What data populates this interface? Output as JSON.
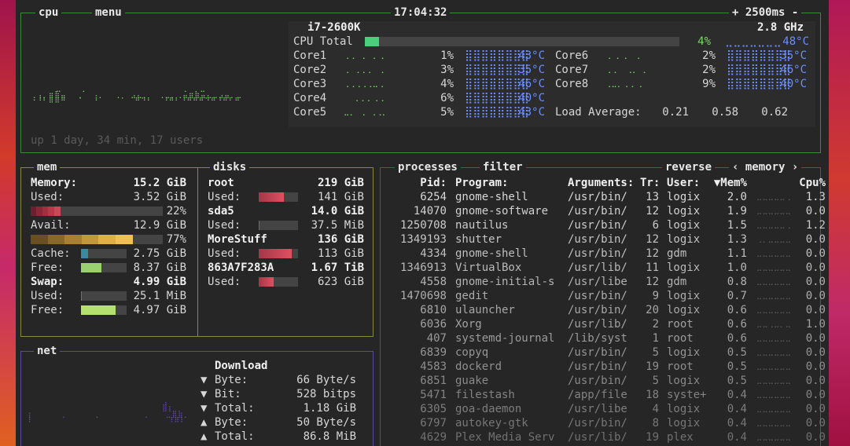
{
  "cpu": {
    "title": "cpu",
    "menu_label": "menu",
    "clock": "17:04:32",
    "interval": "+ 2500ms -",
    "model": "i7-2600K",
    "freq": "2.8 GHz",
    "total": {
      "label": "CPU Total",
      "pct": "4%",
      "temp": "48°C",
      "fill": 0.04
    },
    "cores": [
      {
        "label": "Core1",
        "pct": "1%",
        "temp": "43°C"
      },
      {
        "label": "Core2",
        "pct": "3%",
        "temp": "35°C"
      },
      {
        "label": "Core3",
        "pct": "4%",
        "temp": "46°C"
      },
      {
        "label": "Core4",
        "pct": "6%",
        "temp": "40°C"
      },
      {
        "label": "Core5",
        "pct": "5%",
        "temp": "43°C"
      },
      {
        "label": "Core6",
        "pct": "2%",
        "temp": "35°C"
      },
      {
        "label": "Core7",
        "pct": "2%",
        "temp": "46°C"
      },
      {
        "label": "Core8",
        "pct": "9%",
        "temp": "40°C"
      }
    ],
    "load_label": "Load Average:",
    "load": [
      "0.21",
      "0.58",
      "0.62"
    ],
    "uptime": "up 1 day, 34 min, 17 users"
  },
  "mem": {
    "title": "mem",
    "rows": [
      {
        "label": "Memory:",
        "value": "15.2 GiB",
        "bold": true
      },
      {
        "label": "Used:",
        "value": "3.52 GiB"
      },
      {
        "label": "",
        "value": "22%",
        "bar": 0.22,
        "color": "#c84a5a"
      },
      {
        "label": "Avail:",
        "value": "12.9 GiB"
      },
      {
        "label": "",
        "value": "77%",
        "bar": 0.77,
        "color": "#e0b040"
      },
      {
        "label": "Cache:",
        "value": "2.75 GiB",
        "mini": 0.15,
        "color": "#3a8aa0"
      },
      {
        "label": "Free:",
        "value": "8.37 GiB",
        "mini": 0.45,
        "color": "#9ad070"
      },
      {
        "label": "Swap:",
        "value": "4.99 GiB",
        "bold": true
      },
      {
        "label": "Used:",
        "value": "25.1 MiB",
        "mini": 0.02,
        "color": "#c84a5a"
      },
      {
        "label": "Free:",
        "value": "4.97 GiB",
        "mini": 0.75,
        "color": "#b4e070"
      }
    ]
  },
  "disks": {
    "title": "disks",
    "rows": [
      {
        "label": "root",
        "value": "219 GiB",
        "bold": true
      },
      {
        "label": "Used:",
        "value": "141 GiB",
        "mini": 0.64
      },
      {
        "label": "sda5",
        "value": "14.0 GiB",
        "bold": true
      },
      {
        "label": "Used:",
        "value": "37.5 MiB",
        "mini": 0.0
      },
      {
        "label": "MoreStuff",
        "value": "136 GiB",
        "bold": true
      },
      {
        "label": "Used:",
        "value": "113 GiB",
        "mini": 0.83
      },
      {
        "label": "863A7F283A",
        "value": "1.67 TiB",
        "bold": true
      },
      {
        "label": "Used:",
        "value": "623 GiB",
        "mini": 0.37
      }
    ]
  },
  "net": {
    "title": "net",
    "download_label": "Download",
    "rows": [
      {
        "arrow": "▼",
        "label": "Byte:",
        "value": "66 Byte/s"
      },
      {
        "arrow": "▼",
        "label": "Bit:",
        "value": "528 bitps"
      },
      {
        "arrow": "▼",
        "label": "Total:",
        "value": "1.18 GiB"
      },
      {
        "arrow": "▲",
        "label": "Byte:",
        "value": "50 Byte/s"
      },
      {
        "arrow": "▲",
        "label": "Total:",
        "value": "86.8 MiB"
      }
    ]
  },
  "proc": {
    "title": "processes",
    "filter_label": "filter",
    "reverse_label": "reverse",
    "sort_label": "‹ memory ›",
    "headers": {
      "pid": "Pid:",
      "program": "Program:",
      "args": "Arguments:",
      "tr": "Tr:",
      "user": "User:",
      "mem": "▼Mem%",
      "cpu": "Cpu%"
    },
    "rows": [
      {
        "pid": "6254",
        "program": "gnome-shell",
        "args": "/usr/bin/",
        "tr": "13",
        "user": "logix",
        "mem": "2.0",
        "cpu": "1.3"
      },
      {
        "pid": "14070",
        "program": "gnome-software",
        "args": "/usr/bin/",
        "tr": "12",
        "user": "logix",
        "mem": "1.9",
        "cpu": "0.0"
      },
      {
        "pid": "1250708",
        "program": "nautilus",
        "args": "/usr/bin/",
        "tr": "6",
        "user": "logix",
        "mem": "1.5",
        "cpu": "1.2"
      },
      {
        "pid": "1349193",
        "program": "shutter",
        "args": "/usr/bin/",
        "tr": "12",
        "user": "logix",
        "mem": "1.3",
        "cpu": "0.0"
      },
      {
        "pid": "4334",
        "program": "gnome-shell",
        "args": "/usr/bin/",
        "tr": "12",
        "user": "gdm",
        "mem": "1.1",
        "cpu": "0.0"
      },
      {
        "pid": "1346913",
        "program": "VirtualBox",
        "args": "/usr/lib/",
        "tr": "11",
        "user": "logix",
        "mem": "1.0",
        "cpu": "0.0"
      },
      {
        "pid": "4558",
        "program": "gnome-initial-s",
        "args": "/usr/libe",
        "tr": "12",
        "user": "gdm",
        "mem": "0.8",
        "cpu": "0.0"
      },
      {
        "pid": "1470698",
        "program": "gedit",
        "args": "/usr/bin/",
        "tr": "9",
        "user": "logix",
        "mem": "0.7",
        "cpu": "0.0"
      },
      {
        "pid": "6810",
        "program": "ulauncher",
        "args": "/usr/bin/",
        "tr": "20",
        "user": "logix",
        "mem": "0.6",
        "cpu": "0.0"
      },
      {
        "pid": "6036",
        "program": "Xorg",
        "args": "/usr/lib/",
        "tr": "2",
        "user": "root",
        "mem": "0.6",
        "cpu": "1.0"
      },
      {
        "pid": "407",
        "program": "systemd-journal",
        "args": "/lib/syst",
        "tr": "1",
        "user": "root",
        "mem": "0.6",
        "cpu": "0.0"
      },
      {
        "pid": "6839",
        "program": "copyq",
        "args": "/usr/bin/",
        "tr": "5",
        "user": "logix",
        "mem": "0.5",
        "cpu": "0.0"
      },
      {
        "pid": "4583",
        "program": "dockerd",
        "args": "/usr/bin/",
        "tr": "19",
        "user": "root",
        "mem": "0.5",
        "cpu": "0.0"
      },
      {
        "pid": "6851",
        "program": "guake",
        "args": "/usr/bin/",
        "tr": "5",
        "user": "logix",
        "mem": "0.5",
        "cpu": "0.0"
      },
      {
        "pid": "5471",
        "program": "filestash",
        "args": "/app/file",
        "tr": "18",
        "user": "syste+",
        "mem": "0.4",
        "cpu": "0.0"
      },
      {
        "pid": "6305",
        "program": "goa-daemon",
        "args": "/usr/libe",
        "tr": "4",
        "user": "logix",
        "mem": "0.4",
        "cpu": "0.0"
      },
      {
        "pid": "6797",
        "program": "autokey-gtk",
        "args": "/usr/bin/",
        "tr": "8",
        "user": "logix",
        "mem": "0.4",
        "cpu": "0.0"
      },
      {
        "pid": "4629",
        "program": "Plex Media Serv",
        "args": "/usr/lib/",
        "tr": "19",
        "user": "plex",
        "mem": "0.4",
        "cpu": "0.0"
      }
    ]
  },
  "colors": {
    "cpu_border": "#3a8a3a",
    "mem_border": "#8a8a3a",
    "net_border": "#5a4aa0",
    "proc_border": "#9a3a3a"
  }
}
